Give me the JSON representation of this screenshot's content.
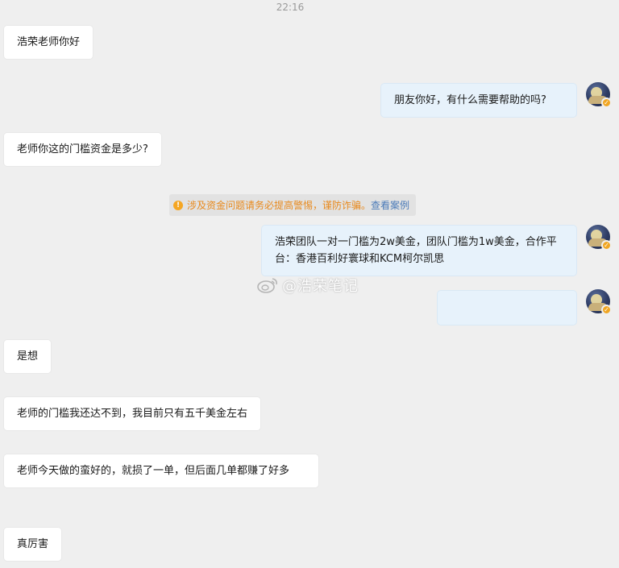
{
  "timestamp": "22:16",
  "messages": [
    {
      "side": "in",
      "text": "浩荣老师你好"
    },
    {
      "side": "out",
      "text": "朋友你好，有什么需要帮助的吗?"
    },
    {
      "side": "in",
      "text": "老师你这的门槛资金是多少?"
    },
    {
      "side": "out",
      "text": "浩荣团队一对一门槛为2w美金，团队门槛为1w美金，合作平台：香港百利好寰球和KCM柯尔凯思"
    },
    {
      "side": "out",
      "text": ""
    },
    {
      "side": "in",
      "text": "是想"
    },
    {
      "side": "in",
      "text": "老师的门槛我还达不到，我目前只有五千美金左右"
    },
    {
      "side": "in",
      "text": "老师今天做的蛮好的，就损了一单，但后面几单都赚了好多"
    },
    {
      "side": "in",
      "text": "真厉害"
    }
  ],
  "notice": {
    "warning_text": "涉及资金问题请务必提高警惕，谨防诈骗。",
    "link_text": "查看案例",
    "icon": "warning-icon",
    "warning_color": "#e8891c",
    "link_color": "#4a7ab8"
  },
  "watermark": {
    "text": "@浩荣笔记",
    "icon": "weibo-icon"
  },
  "colors": {
    "background": "#efefef",
    "incoming_bubble": "#ffffff",
    "outgoing_bubble": "#e7f2fb"
  }
}
